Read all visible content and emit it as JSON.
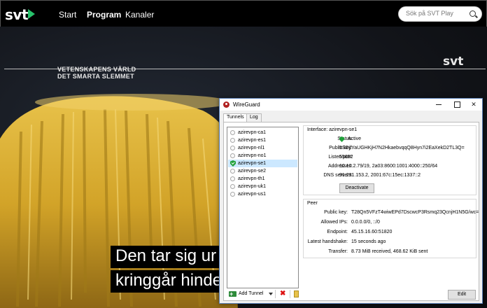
{
  "svt": {
    "logo": "svt",
    "nav": [
      {
        "label": "Start",
        "active": false
      },
      {
        "label": "Program",
        "active": true
      },
      {
        "label": "Kanaler",
        "active": false
      }
    ],
    "search_placeholder": "Sök på SVT Play",
    "colors": {
      "brand_green": "#27c26b"
    }
  },
  "video": {
    "program_title_1": "VETENSKAPENS VÄRLD",
    "program_title_2": "DET SMARTA SLEMMET",
    "watermark": "svt",
    "subtitle_line_1": "Den tar sig ur la",
    "subtitle_line_2": "kringgår hinder"
  },
  "wireguard": {
    "title": "WireGuard",
    "window_controls": {
      "close": "✕"
    },
    "tabs": [
      {
        "label": "Tunnels",
        "active": true
      },
      {
        "label": "Log",
        "active": false
      }
    ],
    "tunnels": [
      {
        "name": "azirevpn-ca1",
        "active": false
      },
      {
        "name": "azirevpn-es1",
        "active": false
      },
      {
        "name": "azirevpn-nl1",
        "active": false
      },
      {
        "name": "azirevpn-no1",
        "active": false
      },
      {
        "name": "azirevpn-se1",
        "active": true
      },
      {
        "name": "azirevpn-se2",
        "active": false
      },
      {
        "name": "azirevpn-th1",
        "active": false
      },
      {
        "name": "azirevpn-uk1",
        "active": false
      },
      {
        "name": "azirevpn-us1",
        "active": false
      }
    ],
    "toolbar": {
      "add_tunnel": "Add Tunnel",
      "delete_icon": "✖"
    },
    "interface": {
      "title": "Interface: azirevpn-se1",
      "status_label": "Status:",
      "status_value": "Active",
      "public_key_label": "Public key:",
      "public_key_value": "5SDjfYaUGHKjH7N2HkaebvqqQ8Hyn7i2EaXekD2TL3Q=",
      "listen_port_label": "Listen port:",
      "listen_port_value": "55652",
      "addresses_label": "Addresses:",
      "addresses_value": "10.10.2.79/19, 2a03:8600:1001:4000::250/64",
      "dns_label": "DNS servers:",
      "dns_value": "91.231.153.2, 2001:67c:15ec:1337::2",
      "deactivate_label": "Deactivate"
    },
    "peer": {
      "title": "Peer",
      "public_key_label": "Public key:",
      "public_key_value": "T28Qn5VFzT4wiwEPd7DscwcP3Rsmq23QcnjH1N5G/wc=",
      "allowed_ips_label": "Allowed IPs:",
      "allowed_ips_value": "0.0.0.0/0, ::/0",
      "endpoint_label": "Endpoint:",
      "endpoint_value": "45.15.16.60:51820",
      "handshake_label": "Latest handshake:",
      "handshake_value": "15 seconds ago",
      "transfer_label": "Transfer:",
      "transfer_value": "8.73 MiB received, 468.62 KiB sent"
    },
    "edit_label": "Edit",
    "colors": {
      "active_green": "#1fa03a",
      "selection": "#cce8ff",
      "app_red": "#b12323"
    }
  }
}
